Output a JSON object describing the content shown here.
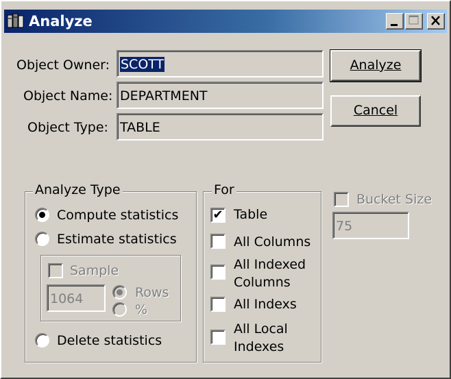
{
  "window": {
    "title": "Analyze"
  },
  "owner": {
    "label": "Object Owner:",
    "value": "SCOTT"
  },
  "name": {
    "label": "Object Name:",
    "value": "DEPARTMENT"
  },
  "type": {
    "label": "Object Type:",
    "value": "TABLE"
  },
  "buttons": {
    "analyze": "Analyze",
    "cancel": "Cancel"
  },
  "analyze_type": {
    "legend": "Analyze Type",
    "compute": "Compute statistics",
    "estimate": "Estimate statistics",
    "sample": "Sample",
    "sample_value": "1064",
    "rows": "Rows",
    "percent": "%",
    "delete": "Delete statistics",
    "selected": "compute"
  },
  "for_group": {
    "legend": "For",
    "table": "Table",
    "all_columns": "All Columns",
    "all_indexed_1": "All Indexed",
    "all_indexed_2": "Columns",
    "all_indexes": "All Indexs",
    "all_local_1": "All Local",
    "all_local_2": "Indexes"
  },
  "bucket": {
    "label": "Bucket Size",
    "value": "75"
  }
}
